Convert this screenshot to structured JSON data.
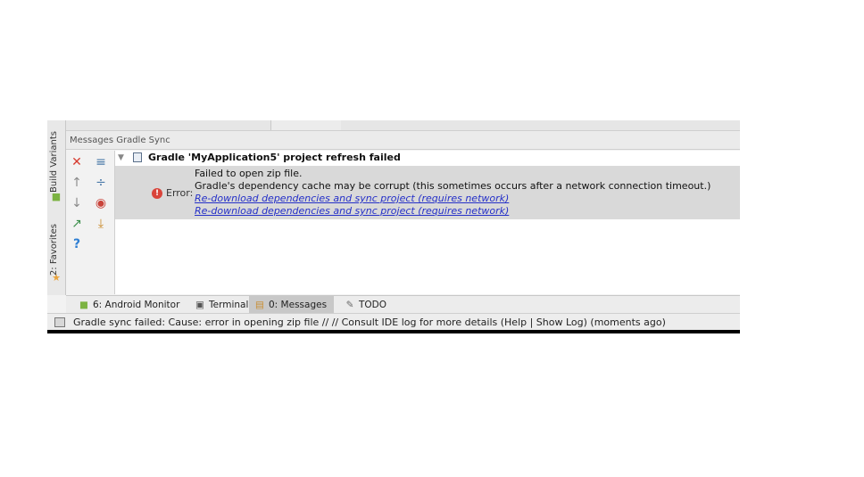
{
  "side_tabs": {
    "build_variants": "Build Variants",
    "favorites": "2: Favorites"
  },
  "panel": {
    "header_title": "Messages Gradle Sync"
  },
  "toolbar_icons": [
    "close-icon",
    "expand-all-icon",
    "up-arrow-icon",
    "collapse-all-icon",
    "down-arrow-icon",
    "clear-icon",
    "export-icon",
    "download-icon",
    "help-icon"
  ],
  "tree": {
    "title": "Gradle 'MyApplication5' project refresh failed",
    "error_label": "Error:",
    "lines": [
      "Failed to open zip file.",
      "Gradle's dependency cache may be corrupt (this sometimes occurs after a network connection timeout.)"
    ],
    "links": [
      "Re-download dependencies and sync project (requires network)",
      "Re-download dependencies and sync project (requires network)"
    ]
  },
  "bottom_tabs": [
    {
      "label": "6: Android Monitor",
      "icon": "android-icon"
    },
    {
      "label": "Terminal",
      "icon": "terminal-icon"
    },
    {
      "label": "0: Messages",
      "icon": "messages-icon",
      "active": true
    },
    {
      "label": "TODO",
      "icon": "todo-icon"
    }
  ],
  "status": {
    "text": "Gradle sync failed: Cause: error in opening zip file // // Consult IDE log for more details (Help | Show Log) (moments ago)"
  },
  "colors": {
    "link": "#2530c8",
    "error": "#d9443a",
    "selected_row": "#d9d9d9"
  }
}
